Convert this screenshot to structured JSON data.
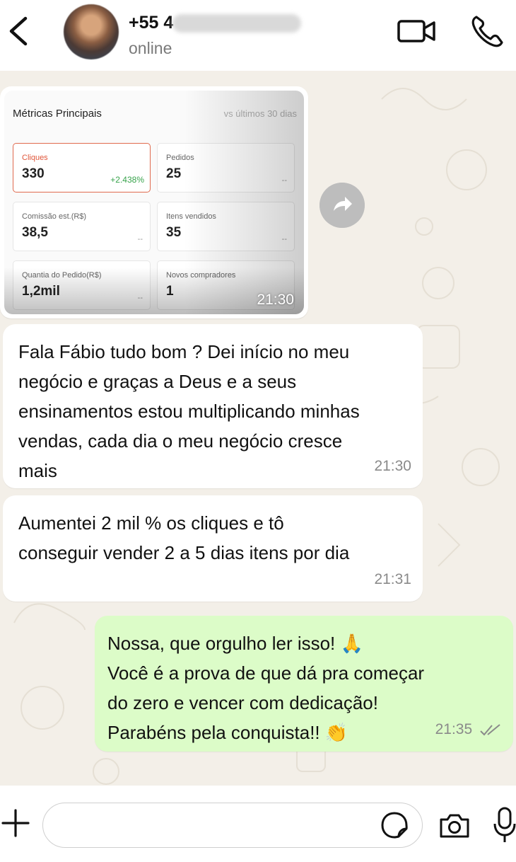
{
  "header": {
    "contact_name": "+55 4",
    "status": "online"
  },
  "image_message": {
    "screenshot": {
      "title": "Métricas Principais",
      "range": "vs últimos 30 dias",
      "cards": [
        {
          "label": "Cliques",
          "value": "330",
          "delta": "+2.438%",
          "active": true
        },
        {
          "label": "Pedidos",
          "value": "25",
          "delta": "--"
        },
        {
          "label": "Comissão est.(R$)",
          "value": "38,5",
          "delta": "--"
        },
        {
          "label": "Itens vendidos",
          "value": "35",
          "delta": "--"
        },
        {
          "label": "Quantia do Pedido(R$)",
          "value": "1,2mil",
          "delta": "--"
        },
        {
          "label": "Novos compradores",
          "value": "1",
          "delta": ""
        }
      ]
    },
    "time": "21:30"
  },
  "messages": [
    {
      "direction": "incoming",
      "lines": [
        "Fala Fábio tudo bom ? Dei início no meu",
        "negócio e graças a Deus e a seus",
        "ensinamentos estou multiplicando minhas",
        "vendas, cada dia o meu negócio cresce",
        "mais"
      ],
      "time": "21:30"
    },
    {
      "direction": "incoming",
      "lines": [
        "Aumentei 2 mil % os cliques e tô",
        "conseguir vender 2 a 5 dias itens por dia"
      ],
      "time": "21:31"
    },
    {
      "direction": "outgoing",
      "lines": [
        "Nossa, que orgulho ler isso! 🙏",
        "Você é a prova de que dá pra começar",
        "do zero e vencer com dedicação!",
        "Parabéns pela conquista!! 👏"
      ],
      "time": "21:35",
      "read": true
    }
  ],
  "composer": {
    "value": "",
    "placeholder": ""
  },
  "colors": {
    "outgoing_bubble": "#dcfcc8",
    "incoming_bubble": "#ffffff",
    "chat_background": "#f3efe8",
    "accent_active": "#e06a4e",
    "delta_positive": "#38a34c",
    "read_ticks": "#8a8a8a"
  },
  "icons": {
    "back": "chevron-left-icon",
    "video": "video-camera-icon",
    "call": "phone-icon",
    "forward": "share-forward-icon",
    "attach": "plus-icon",
    "sticker": "sticker-icon",
    "camera": "camera-icon",
    "mic": "microphone-icon"
  }
}
